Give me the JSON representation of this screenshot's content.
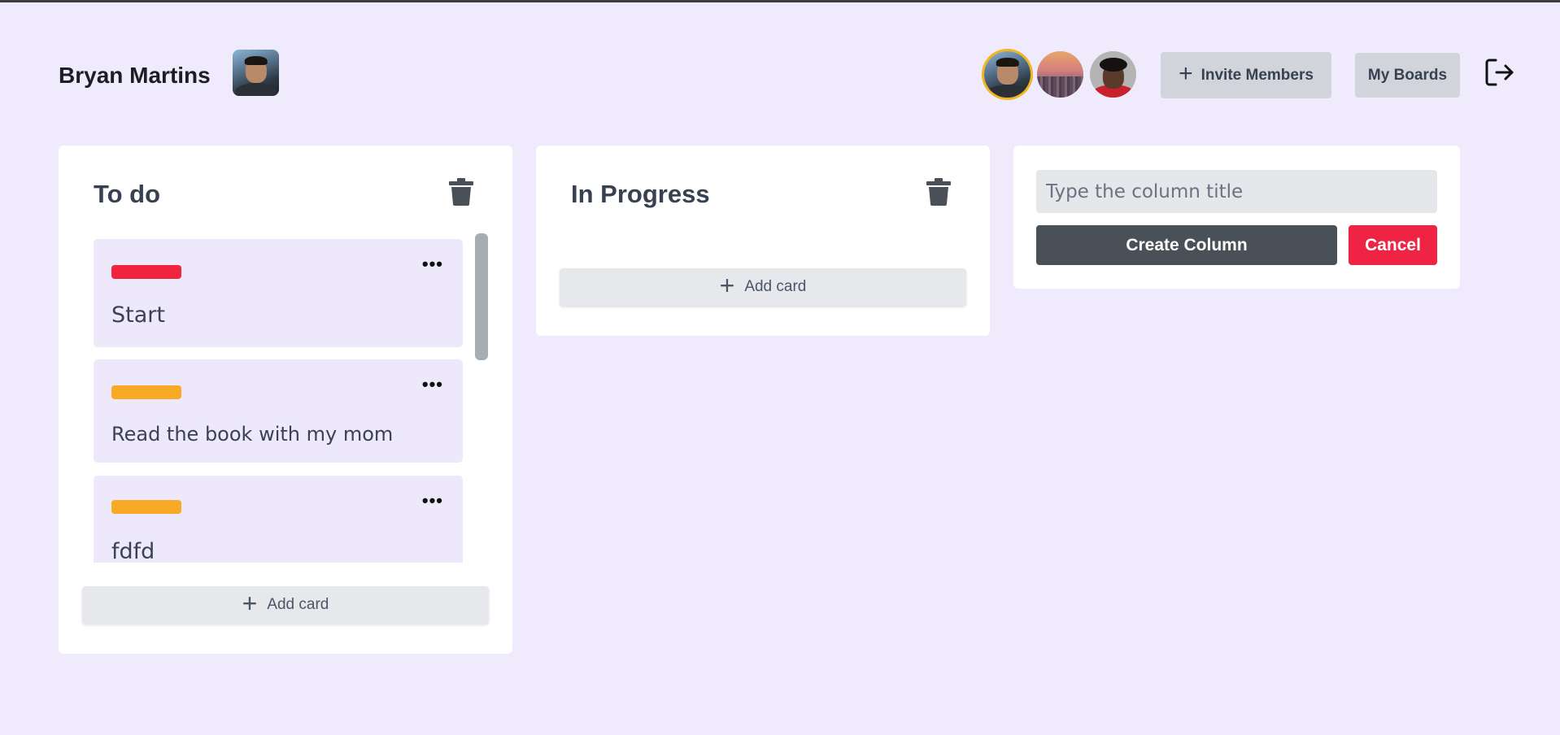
{
  "header": {
    "user_name": "Bryan Martins",
    "invite_label": "Invite Members",
    "boards_label": "My Boards"
  },
  "columns": [
    {
      "title": "To do",
      "cards": [
        {
          "tag_color": "#f0243f",
          "text": "Start"
        },
        {
          "tag_color": "#f8a925",
          "text": "Read the book with my mom"
        },
        {
          "tag_color": "#f8a925",
          "text": "fdfd"
        }
      ],
      "add_label": "Add card"
    },
    {
      "title": "In Progress",
      "cards": [],
      "add_label": "Add card"
    }
  ],
  "new_column": {
    "placeholder": "Type the column title",
    "create_label": "Create Column",
    "cancel_label": "Cancel"
  },
  "colors": {
    "background": "#efeafc",
    "accent_danger": "#ef2343",
    "create_button": "#4a5057",
    "active_member_ring": "#f2b51a"
  },
  "icons": [
    "user-avatar",
    "member-avatar",
    "plus-icon",
    "logout-icon",
    "trash-icon",
    "more-dots-icon"
  ]
}
